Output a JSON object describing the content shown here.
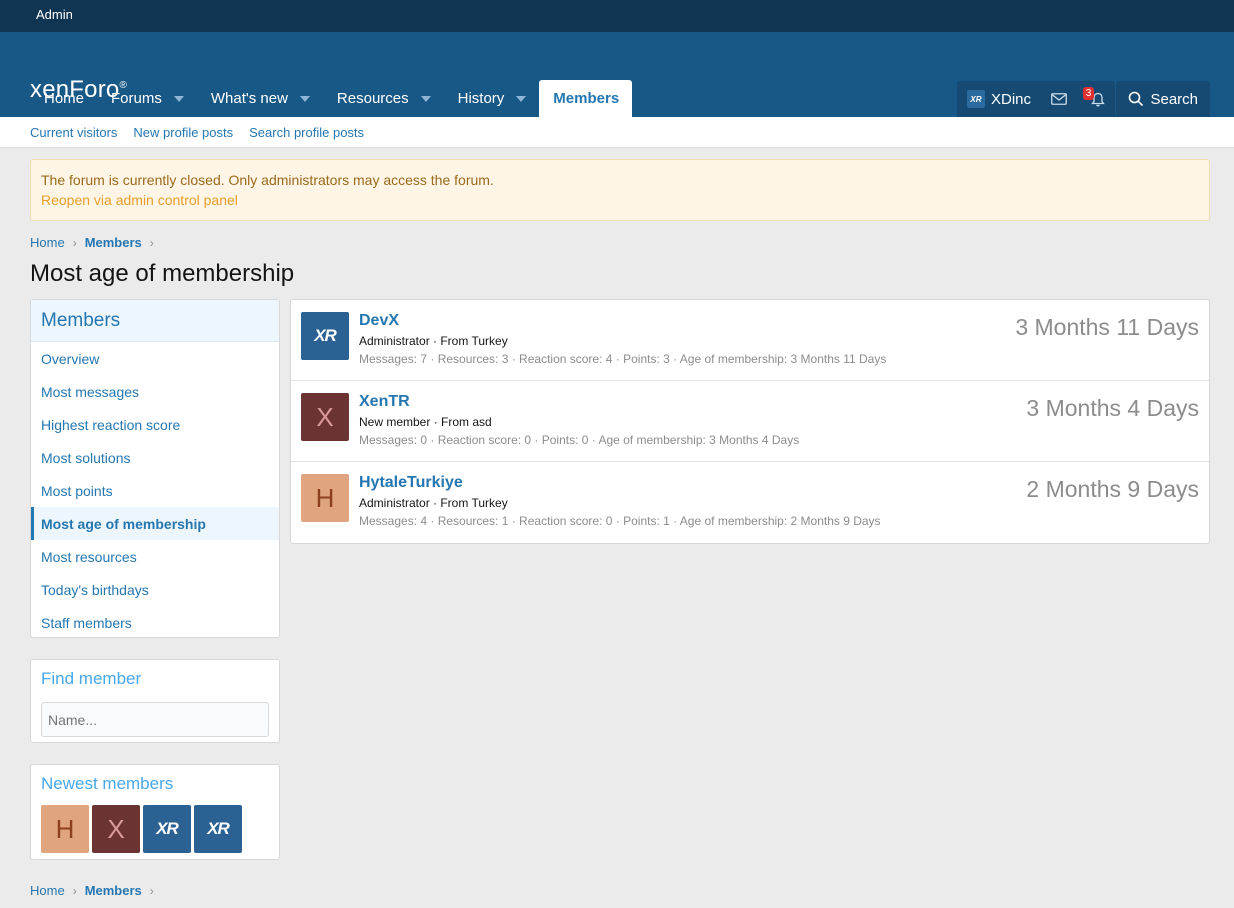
{
  "admin_bar": {
    "label": "Admin"
  },
  "logo": {
    "text": "xenForo",
    "sup": "®"
  },
  "nav": {
    "tabs": [
      {
        "label": "Home",
        "caret": false
      },
      {
        "label": "Forums",
        "caret": true
      },
      {
        "label": "What's new",
        "caret": true
      },
      {
        "label": "Resources",
        "caret": true
      },
      {
        "label": "History",
        "caret": true
      },
      {
        "label": "Members",
        "caret": false,
        "active": true
      }
    ]
  },
  "user": {
    "name": "XDinc",
    "alerts_count": "3",
    "avatar_text": "XR"
  },
  "search": {
    "label": "Search"
  },
  "subnav": [
    "Current visitors",
    "New profile posts",
    "Search profile posts"
  ],
  "notice": {
    "text": "The forum is currently closed. Only administrators may access the forum.",
    "link": "Reopen via admin control panel"
  },
  "breadcrumb": {
    "home": "Home",
    "current": "Members"
  },
  "page_title": "Most age of membership",
  "sidebar": {
    "title": "Members",
    "items": [
      {
        "label": "Overview"
      },
      {
        "label": "Most messages"
      },
      {
        "label": "Highest reaction score"
      },
      {
        "label": "Most solutions"
      },
      {
        "label": "Most points"
      },
      {
        "label": "Most age of membership",
        "selected": true
      },
      {
        "label": "Most resources"
      },
      {
        "label": "Today's birthdays"
      },
      {
        "label": "Staff members"
      }
    ]
  },
  "find_member": {
    "title": "Find member",
    "placeholder": "Name..."
  },
  "newest_members": {
    "title": "Newest members",
    "avatars": [
      "H",
      "X",
      "XR",
      "XR"
    ]
  },
  "members": [
    {
      "name": "DevX",
      "avatar": "XR",
      "info": "Administrator · From Turkey",
      "stats": "Messages: 7 · Resources: 3 · Reaction score: 4 · Points: 3 · Age of membership: 3 Months 11 Days",
      "age": "3 Months 11 Days"
    },
    {
      "name": "XenTR",
      "avatar": "X",
      "info": "New member · From asd",
      "stats": "Messages: 0 · Reaction score: 0 · Points: 0 · Age of membership: 3 Months 4 Days",
      "age": "3 Months 4 Days"
    },
    {
      "name": "HytaleTurkiye",
      "avatar": "H",
      "info": "Administrator · From Turkey",
      "stats": "Messages: 4 · Resources: 1 · Reaction score: 0 · Points: 1 · Age of membership: 2 Months 9 Days",
      "age": "2 Months 9 Days"
    }
  ],
  "colors": {
    "header": "#185886",
    "admin_bar": "#0f3552",
    "link": "#2577b1",
    "notice_bg": "#fef5e6"
  }
}
